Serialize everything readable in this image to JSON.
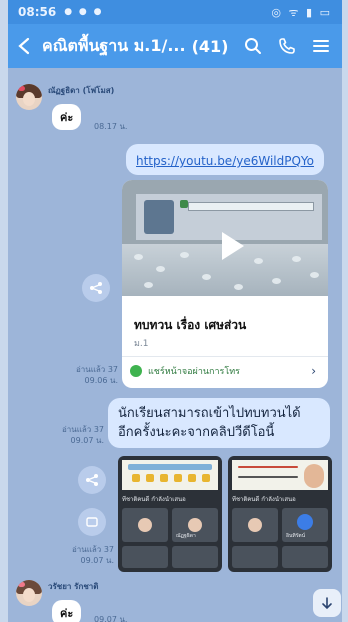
{
  "status_bar": {
    "time": "08:56",
    "notification_dots": "● ● ●",
    "system_icons": "◎ ᯤ ▮ ▭"
  },
  "header": {
    "title": "คณิตพื้นฐาน ม.1/...",
    "member_count": "(41)"
  },
  "messages": {
    "msg1": {
      "sender": "ณัฏฐธิดา (โฟโมส)",
      "text": "ค่ะ",
      "time": "08.17 น."
    },
    "link_msg": {
      "url": "https://youtu.be/ye6WildPQYo"
    },
    "link_card": {
      "title": "ทบทวน เรื่อง เศษส่วน",
      "subtitle": "ม.1",
      "footer": "แชร์หน้าจอผ่านการโทร",
      "read": "อ่านแล้ว 37",
      "time": "09.06 น."
    },
    "text_msg": {
      "line1": "นักเรียนสามารถเข้าไปทบทวนได้",
      "line2": "อีกครั้งนะคะจากคลิปวีดีโอนี้",
      "read": "อ่านแล้ว 37",
      "time": "09.07 น."
    },
    "image_msg": {
      "read": "อ่านแล้ว 37",
      "time": "09.07 น.",
      "shot1_label": "ทีชาติคนดี กำลังนำเสนอ",
      "shot2_label": "ทีชาติคนดี กำลังนำเสนอ",
      "shot1_name": "ณัฏฐธิดา",
      "shot2_name": "อินทิรัตน์"
    },
    "msg_last": {
      "sender": "วรัชยา รักชาติ",
      "text": "ค่ะ",
      "time": "09.07 น."
    }
  },
  "colors": {
    "header": "#4a9aea",
    "chat_bg": "#9db5d9",
    "out_bubble": "#d9e8ff",
    "link": "#2563c9"
  }
}
